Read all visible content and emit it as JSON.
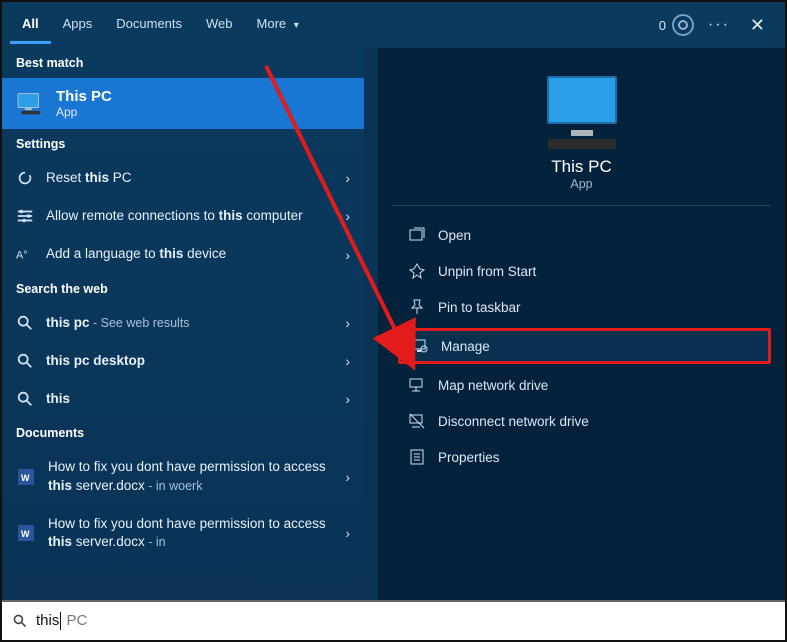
{
  "topbar": {
    "tabs": [
      {
        "label": "All",
        "active": true
      },
      {
        "label": "Apps",
        "active": false
      },
      {
        "label": "Documents",
        "active": false
      },
      {
        "label": "Web",
        "active": false
      },
      {
        "label": "More",
        "active": false,
        "dropdown": true
      }
    ],
    "points": "0"
  },
  "left": {
    "best_header": "Best match",
    "best": {
      "title": "This PC",
      "sub": "App"
    },
    "settings_header": "Settings",
    "settings": [
      {
        "pre": "Reset ",
        "strong": "this",
        "post": " PC"
      },
      {
        "pre": "Allow remote connections to ",
        "strong": "this",
        "post": " computer"
      },
      {
        "pre": "Add a language to ",
        "strong": "this",
        "post": " device"
      }
    ],
    "web_header": "Search the web",
    "web": [
      {
        "strong": "this pc",
        "post": " - See web results"
      },
      {
        "strong": "this pc desktop",
        "post": ""
      },
      {
        "strong": "this",
        "post": ""
      }
    ],
    "docs_header": "Documents",
    "docs": [
      {
        "pre": "How to fix you dont have permission to access ",
        "strong": "this",
        "post": " server.docx",
        "loc": " - in woerk"
      },
      {
        "pre": "How to fix you dont have permission to access ",
        "strong": "this",
        "post": " server.docx",
        "loc": " - in"
      }
    ]
  },
  "preview": {
    "title": "This PC",
    "sub": "App",
    "actions": [
      {
        "id": "open",
        "label": "Open"
      },
      {
        "id": "unpin",
        "label": "Unpin from Start"
      },
      {
        "id": "pin-taskbar",
        "label": "Pin to taskbar"
      },
      {
        "id": "manage",
        "label": "Manage",
        "highlight": true
      },
      {
        "id": "map",
        "label": "Map network drive"
      },
      {
        "id": "disconnect",
        "label": "Disconnect network drive"
      },
      {
        "id": "properties",
        "label": "Properties"
      }
    ]
  },
  "search": {
    "typed": "this",
    "ghost": " PC"
  },
  "annotation": {
    "target": "manage"
  }
}
